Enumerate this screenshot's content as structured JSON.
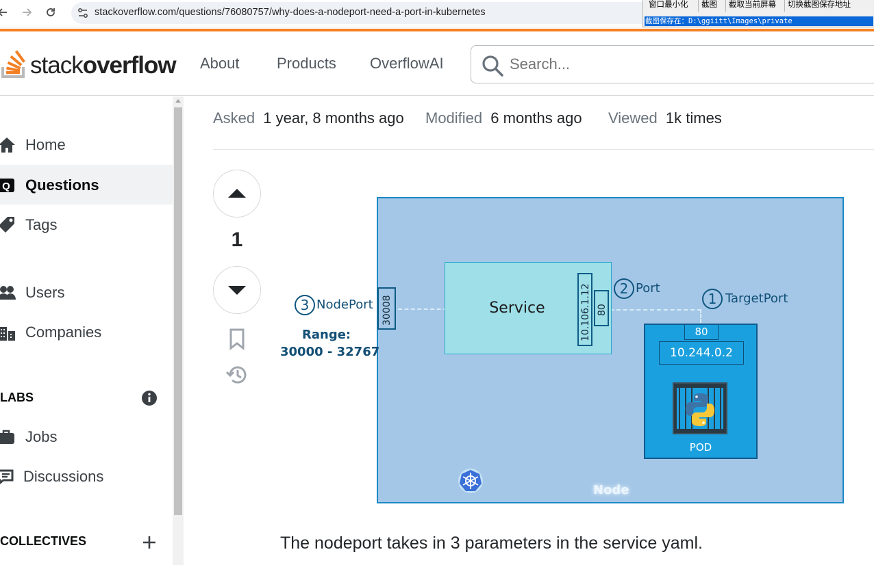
{
  "browser": {
    "url": "stackoverflow.com/questions/76080757/why-does-a-nodeport-need-a-port-in-kubernetes"
  },
  "capture_tool": {
    "buttons": [
      "窗口最小化",
      "截图",
      "截取当前屏幕",
      "切换截图保存地址"
    ],
    "save_path": "截图保存在：D:\\ggiitt\\Images\\private"
  },
  "header": {
    "logo_light": "stack",
    "logo_bold": "overflow",
    "nav": [
      "About",
      "Products",
      "OverflowAI"
    ],
    "search_placeholder": "Search..."
  },
  "sidebar": {
    "items": [
      {
        "label": "Home",
        "icon": "home-icon"
      },
      {
        "label": "Questions",
        "icon": "questions-icon",
        "active": true
      },
      {
        "label": "Tags",
        "icon": "tag-icon"
      },
      {
        "label": "Users",
        "icon": "users-icon"
      },
      {
        "label": "Companies",
        "icon": "companies-icon"
      }
    ],
    "labs_heading": "LABS",
    "labs_items": [
      {
        "label": "Jobs",
        "icon": "briefcase-icon"
      },
      {
        "label": "Discussions",
        "icon": "discussions-icon"
      }
    ],
    "collectives_heading": "COLLECTIVES"
  },
  "question": {
    "asked_label": "Asked",
    "asked_value": "1 year, 8 months ago",
    "modified_label": "Modified",
    "modified_value": "6 months ago",
    "viewed_label": "Viewed",
    "viewed_value": "1k times",
    "vote_count": "1",
    "body_text": "The nodeport takes in 3 parameters in the service yaml."
  },
  "diagram": {
    "service": "Service",
    "nodeport_num": "3",
    "nodeport": "NodePort",
    "range_label": "Range:",
    "range_value": "30000 - 32767",
    "nodeport_value": "30008",
    "service_ip": "10.106.1.12",
    "service_port": "80",
    "port_num": "2",
    "port": "Port",
    "targetport_num": "1",
    "targetport": "TargetPort",
    "pod_port": "80",
    "pod_ip": "10.244.0.2",
    "pod": "POD",
    "node": "Node"
  },
  "colors": {
    "accent": "#f48024",
    "node_fill": "#a4c7e7",
    "pod_fill": "#1ba0df"
  }
}
